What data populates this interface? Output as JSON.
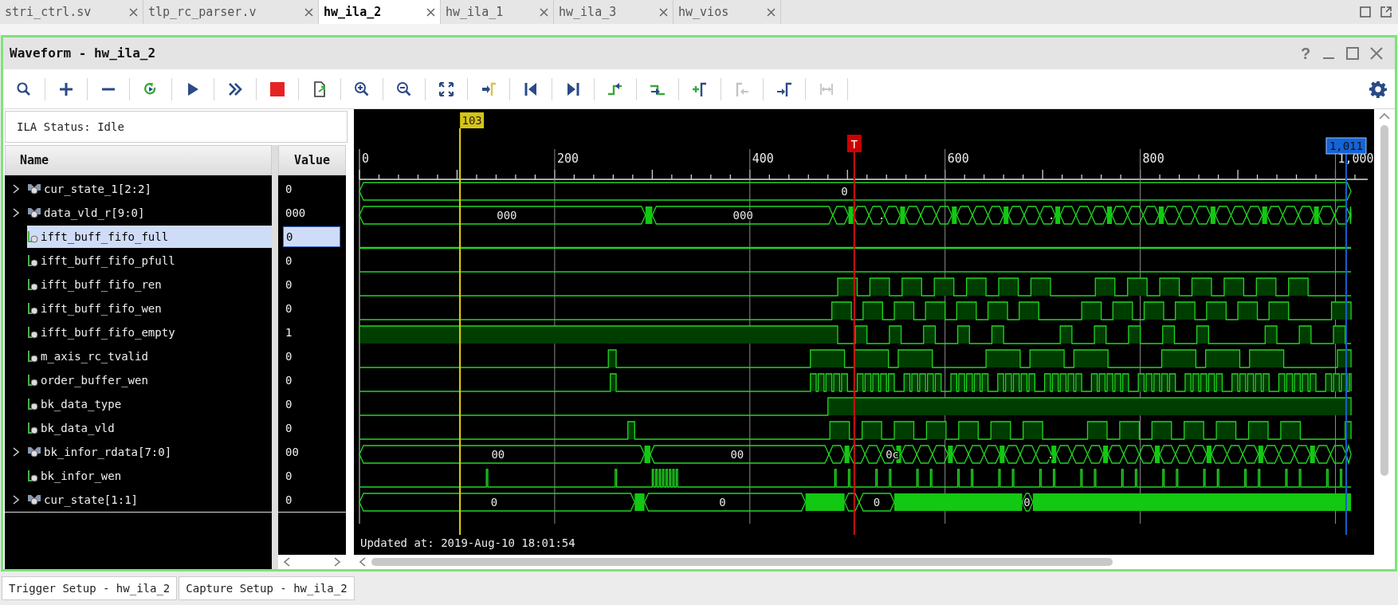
{
  "top_tabs": [
    {
      "label": "stri_ctrl.sv",
      "selected": false
    },
    {
      "label": "tlp_rc_parser.v",
      "selected": false
    },
    {
      "label": "hw_ila_2",
      "selected": true
    },
    {
      "label": "hw_ila_1",
      "selected": false
    },
    {
      "label": "hw_ila_3",
      "selected": false
    },
    {
      "label": "hw_vios",
      "selected": false
    }
  ],
  "panel": {
    "title": "Waveform - hw_ila_2",
    "help": "?"
  },
  "toolbar": [
    {
      "disabled": false
    },
    {
      "disabled": false
    },
    {
      "disabled": false
    },
    {
      "disabled": false
    },
    {
      "disabled": false
    },
    {
      "disabled": false
    },
    {
      "disabled": false
    },
    {
      "disabled": false
    },
    {
      "disabled": false
    },
    {
      "disabled": false
    },
    {
      "disabled": false
    },
    {
      "disabled": false
    },
    {
      "disabled": false
    },
    {
      "disabled": false
    },
    {
      "disabled": false
    },
    {
      "disabled": false
    },
    {
      "disabled": false
    },
    {
      "disabled": true
    },
    {
      "disabled": false
    },
    {
      "disabled": true
    }
  ],
  "ila_status": "ILA Status: Idle",
  "columns": [
    "Name",
    "Value"
  ],
  "signals": [
    {
      "kind": "bus",
      "name": "cur_state_1[2:2]",
      "value": "0",
      "selected": false,
      "wave_labels": [
        "0"
      ]
    },
    {
      "kind": "bus",
      "name": "data_vld_r[9:0]",
      "value": "000",
      "selected": false,
      "wave_labels": [
        "000",
        "000",
        ".",
        "."
      ]
    },
    {
      "kind": "bit",
      "name": "ifft_buff_fifo_full",
      "value": "0",
      "selected": true
    },
    {
      "kind": "bit",
      "name": "ifft_buff_fifo_pfull",
      "value": "0",
      "selected": false
    },
    {
      "kind": "bit",
      "name": "ifft_buff_fifo_ren",
      "value": "0",
      "selected": false
    },
    {
      "kind": "bit",
      "name": "ifft_buff_fifo_wen",
      "value": "0",
      "selected": false
    },
    {
      "kind": "bit",
      "name": "ifft_buff_fifo_empty",
      "value": "1",
      "selected": false
    },
    {
      "kind": "bit",
      "name": "m_axis_rc_tvalid",
      "value": "0",
      "selected": false
    },
    {
      "kind": "bit",
      "name": "order_buffer_wen",
      "value": "0",
      "selected": false
    },
    {
      "kind": "bit",
      "name": "bk_data_type",
      "value": "0",
      "selected": false
    },
    {
      "kind": "bit",
      "name": "bk_data_vld",
      "value": "0",
      "selected": false
    },
    {
      "kind": "bus",
      "name": "bk_infor_rdata[7:0]",
      "value": "00",
      "selected": false,
      "wave_labels": [
        "00",
        "00",
        "0c",
        "."
      ]
    },
    {
      "kind": "bit",
      "name": "bk_infor_wen",
      "value": "0",
      "selected": false
    },
    {
      "kind": "bus",
      "name": "cur_state[1:1]",
      "value": "0",
      "selected": false,
      "wave_labels": [
        "0",
        "0",
        "0",
        "0"
      ]
    }
  ],
  "waveform": {
    "markers": [
      {
        "kind": "cursor",
        "label": "103"
      },
      {
        "kind": "trigger",
        "label": "T"
      },
      {
        "kind": "second_cursor",
        "label": "1,011"
      }
    ],
    "ruler": [
      "0",
      "200",
      "400",
      "600",
      "800",
      "1,000"
    ],
    "updated": "Updated at: 2019-Aug-10 18:01:54"
  },
  "bottom_tabs": [
    "Trigger Setup - hw_ila_2",
    "Capture Setup - hw_ila_2"
  ]
}
